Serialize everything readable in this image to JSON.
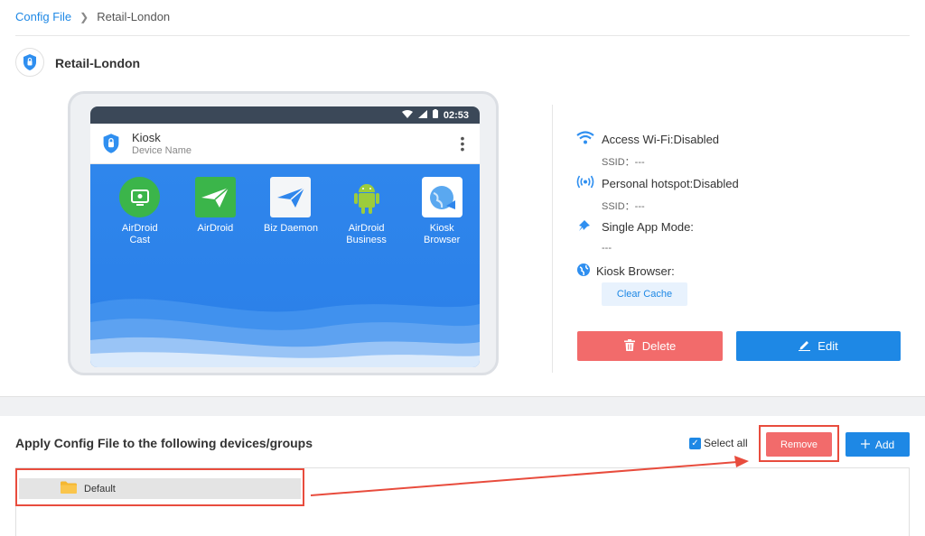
{
  "breadcrumb": {
    "root": "Config File",
    "current": "Retail-London"
  },
  "profile": {
    "name": "Retail-London"
  },
  "preview": {
    "status_time": "02:53",
    "kiosk_title": "Kiosk",
    "kiosk_subtitle": "Device Name",
    "apps": [
      {
        "label_line1": "AirDroid",
        "label_line2": "Cast",
        "icon": "airdroid-cast-icon"
      },
      {
        "label_line1": "AirDroid",
        "label_line2": "",
        "icon": "airdroid-icon"
      },
      {
        "label_line1": "Biz Daemon",
        "label_line2": "",
        "icon": "biz-daemon-icon"
      },
      {
        "label_line1": "AirDroid",
        "label_line2": "Business",
        "icon": "airdroid-business-icon"
      },
      {
        "label_line1": "Kiosk",
        "label_line2": "Browser",
        "icon": "kiosk-browser-icon"
      }
    ]
  },
  "info": {
    "wifi_label": "Access Wi-Fi:Disabled",
    "wifi_ssid": "SSID：---",
    "hotspot_label": "Personal hotspot:Disabled",
    "hotspot_ssid": "SSID：---",
    "single_app_label": "Single App Mode:",
    "single_app_value": "---",
    "browser_label": "Kiosk Browser:",
    "clear_cache_label": "Clear Cache"
  },
  "actions": {
    "delete_label": "Delete",
    "edit_label": "Edit"
  },
  "apply": {
    "title": "Apply Config File to the following devices/groups",
    "select_all_label": "Select all",
    "select_all_checked": true,
    "remove_label": "Remove",
    "add_label": "Add",
    "groups": [
      {
        "name": "Default"
      }
    ]
  },
  "colors": {
    "primary": "#1e88e5",
    "danger": "#f26b6b",
    "highlight": "#e84c3d",
    "screen_bg": "#2f86ec"
  }
}
